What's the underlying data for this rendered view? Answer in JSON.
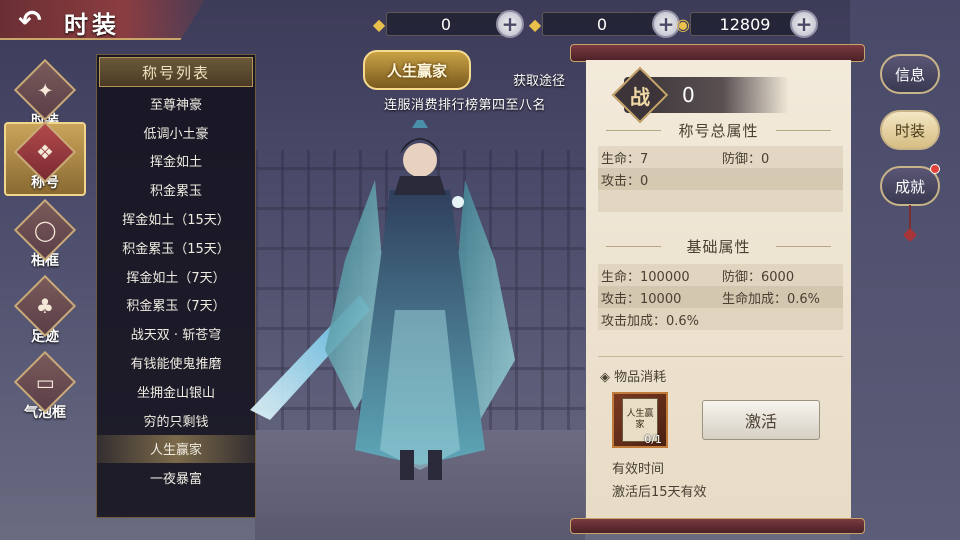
{
  "header": {
    "title": "时装",
    "back_icon": "back-arrow-icon"
  },
  "currency": [
    {
      "icon": "gold-ingot-icon",
      "value": "0"
    },
    {
      "icon": "bound-ingot-icon",
      "value": "0"
    },
    {
      "icon": "copper-coin-icon",
      "value": "12809"
    }
  ],
  "nav": [
    {
      "label": "时装",
      "icon": "outfit-icon"
    },
    {
      "label": "称号",
      "icon": "title-icon",
      "active": true
    },
    {
      "label": "相框",
      "icon": "frame-icon"
    },
    {
      "label": "足迹",
      "icon": "footprint-icon"
    },
    {
      "label": "气泡框",
      "icon": "bubble-icon"
    }
  ],
  "title_list": {
    "header": "称号列表",
    "items": [
      "至尊神豪",
      "低调小土豪",
      "挥金如土",
      "积金累玉",
      "挥金如土（15天）",
      "积金累玉（15天）",
      "挥金如土（7天）",
      "积金累玉（7天）",
      "战天双 · 斩苍穹",
      "有钱能使鬼推磨",
      "坐拥金山银山",
      "穷的只剩钱",
      "人生赢家",
      "一夜暴富"
    ],
    "selected_index": 12
  },
  "obtain": {
    "badge": "人生赢家",
    "title": "获取途径",
    "desc": "连服消费排行榜第四至八名"
  },
  "attributes": {
    "power_icon": "战",
    "power_value": "0",
    "total_title": "称号总属性",
    "total_rows": [
      [
        "生命：7",
        "防御：0"
      ],
      [
        "攻击：0",
        ""
      ],
      [
        "",
        ""
      ]
    ],
    "base_title": "基础属性",
    "base_rows": [
      [
        "生命：100000",
        "防御：6000"
      ],
      [
        "攻击：10000",
        "生命加成：0.6%"
      ],
      [
        "攻击加成：0.6%",
        ""
      ]
    ],
    "consume_title": "◈ 物品消耗",
    "item_name": "人生赢家",
    "item_count": "0/1",
    "activate_label": "激活",
    "valid_label": "有效时间",
    "valid_value": "激活后15天有效"
  },
  "side_buttons": [
    {
      "label": "信息"
    },
    {
      "label": "时装",
      "active": true
    },
    {
      "label": "成就",
      "alert": true
    }
  ]
}
